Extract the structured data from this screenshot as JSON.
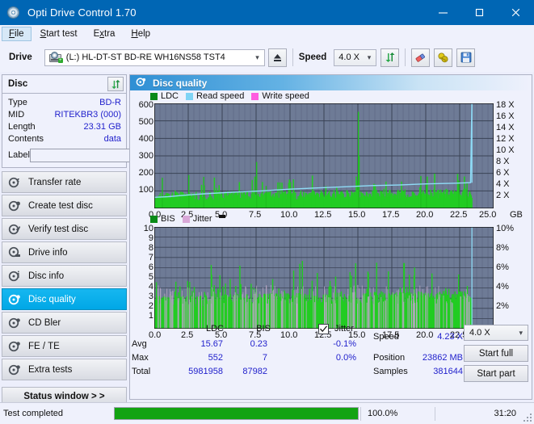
{
  "window": {
    "title": "Opti Drive Control 1.70",
    "icon": "disc-icon",
    "minimize": "minimize-icon",
    "maximize": "maximize-icon",
    "close": "close-icon",
    "titlebar_color": "#0066b4"
  },
  "menubar": {
    "items": [
      {
        "label": "File",
        "mnemonic": "F",
        "active": true
      },
      {
        "label": "Start test",
        "mnemonic": "S",
        "active": false
      },
      {
        "label": "Extra",
        "mnemonic": "x",
        "active": false
      },
      {
        "label": "Help",
        "mnemonic": "H",
        "active": false
      }
    ]
  },
  "toolbar": {
    "drive_label": "Drive",
    "drive_value": "(L:)  HL-DT-ST BD-RE  WH16NS58 TST4",
    "drive_icon": "drive-icon",
    "eject_icon": "eject-icon",
    "speed_label": "Speed",
    "speed_value": "4.0 X",
    "refresh_icon": "refresh-icon",
    "eraser_icon": "eraser-icon",
    "bulb_icon": "bulb-icon",
    "save_icon": "save-icon"
  },
  "disc_panel": {
    "title": "Disc",
    "refresh_icon": "refresh-icon",
    "rows": [
      {
        "key": "Type",
        "value": "BD-R"
      },
      {
        "key": "MID",
        "value": "RITEKBR3 (000)"
      },
      {
        "key": "Length",
        "value": "23.31 GB"
      },
      {
        "key": "Contents",
        "value": "data"
      }
    ],
    "label_key": "Label",
    "label_value": "",
    "label_placeholder": "",
    "label_icon": "cd-icon"
  },
  "sidebar": {
    "items": [
      {
        "label": "Transfer rate",
        "icon": "disc-test-icon",
        "selected": false
      },
      {
        "label": "Create test disc",
        "icon": "disc-write-icon",
        "selected": false
      },
      {
        "label": "Verify test disc",
        "icon": "disc-verify-icon",
        "selected": false
      },
      {
        "label": "Drive info",
        "icon": "drive-info-icon",
        "selected": false
      },
      {
        "label": "Disc info",
        "icon": "disc-info-icon",
        "selected": false
      },
      {
        "label": "Disc quality",
        "icon": "disc-quality-icon",
        "selected": true
      },
      {
        "label": "CD Bler",
        "icon": "cd-bler-icon",
        "selected": false
      },
      {
        "label": "FE / TE",
        "icon": "fe-te-icon",
        "selected": false
      },
      {
        "label": "Extra tests",
        "icon": "extra-tests-icon",
        "selected": false
      }
    ],
    "status_window_button": "Status window > >"
  },
  "main": {
    "title": "Disc quality",
    "icon": "disc-quality-icon"
  },
  "chart_data": [
    {
      "type": "line",
      "name": "ldc-chart",
      "title": "",
      "xlabel": "GB",
      "ylabel": "",
      "xlim": [
        0,
        25
      ],
      "xticks": [
        "0.0",
        "2.5",
        "5.0",
        "7.5",
        "10.0",
        "12.5",
        "15.0",
        "17.5",
        "20.0",
        "22.5",
        "25.0"
      ],
      "ylim": [
        0,
        600
      ],
      "yticks": [
        "100",
        "200",
        "300",
        "400",
        "500",
        "600"
      ],
      "y2label": "X",
      "y2lim": [
        0,
        18
      ],
      "y2ticks": [
        "2 X",
        "4 X",
        "6 X",
        "8 X",
        "10 X",
        "12 X",
        "14 X",
        "16 X",
        "18 X"
      ],
      "grid": true,
      "legend_position": "top-left",
      "plot_bg": "#6e7b96",
      "legend": [
        {
          "label": "LDC",
          "color": "#0a8a18"
        },
        {
          "label": "Read speed",
          "color": "#7fd4f5"
        },
        {
          "label": "Write speed",
          "color": "#ff5ce0"
        }
      ],
      "series": [
        {
          "name": "LDC",
          "color": "#22cc22",
          "type": "bar",
          "note": "dense green error bars, baseline ~40-90, spikes to 170/260/552",
          "x_end": 23.4,
          "avg": 15.67,
          "max": 552,
          "total": 5981958
        },
        {
          "name": "Read speed",
          "color": "#7fd4f5",
          "type": "line",
          "points": [
            [
              0.0,
              1.9
            ],
            [
              1.0,
              2.0
            ],
            [
              2.0,
              2.2
            ],
            [
              3.0,
              2.4
            ],
            [
              4.5,
              2.6
            ],
            [
              6.0,
              2.8
            ],
            [
              8.0,
              3.0
            ],
            [
              10.0,
              3.3
            ],
            [
              12.0,
              3.5
            ],
            [
              14.0,
              3.7
            ],
            [
              16.0,
              3.9
            ],
            [
              18.0,
              4.0
            ],
            [
              20.0,
              4.2
            ],
            [
              22.0,
              4.3
            ],
            [
              23.3,
              4.4
            ],
            [
              23.4,
              18.0
            ]
          ]
        }
      ]
    },
    {
      "type": "bar",
      "name": "bis-chart",
      "title": "",
      "xlabel": "GB",
      "ylabel": "",
      "xlim": [
        0,
        25
      ],
      "xticks": [
        "0.0",
        "2.5",
        "5.0",
        "7.5",
        "10.0",
        "12.5",
        "15.0",
        "17.5",
        "20.0",
        "22.5",
        "25.0"
      ],
      "ylim": [
        0,
        10
      ],
      "yticks": [
        "1",
        "2",
        "3",
        "4",
        "5",
        "6",
        "7",
        "8",
        "9",
        "10"
      ],
      "y2lim": [
        0,
        10
      ],
      "y2ticks": [
        "2%",
        "4%",
        "6%",
        "8%",
        "10%"
      ],
      "grid": true,
      "legend_position": "top-left",
      "plot_bg": "#6e7b96",
      "legend": [
        {
          "label": "BIS",
          "color": "#0a8a18"
        },
        {
          "label": "Jitter",
          "color": "#d8a8d8"
        }
      ],
      "series": [
        {
          "name": "BIS",
          "color": "#22cc22",
          "type": "bar",
          "note": "dense green bars baseline ~2-4, spikes to 5-7 toward end",
          "x_end": 23.4,
          "avg": 0.23,
          "max": 7,
          "total": 87982
        }
      ]
    }
  ],
  "stats": {
    "col_headers": [
      "LDC",
      "BIS"
    ],
    "row_labels": [
      "Avg",
      "Max",
      "Total"
    ],
    "ldc": {
      "avg": "15.67",
      "max": "552",
      "total": "5981958"
    },
    "bis": {
      "avg": "0.23",
      "max": "7",
      "total": "87982"
    },
    "jitter": {
      "label": "Jitter",
      "checked": true,
      "avg": "-0.1%",
      "max": "0.0%"
    },
    "speed_label": "Speed",
    "speed_value": "4.23 X",
    "position_label": "Position",
    "position_value": "23862 MB",
    "samples_label": "Samples",
    "samples_value": "381644",
    "speed_select": "4.0 X",
    "start_full_button": "Start full",
    "start_part_button": "Start part"
  },
  "statusbar": {
    "message": "Test completed",
    "progress_percent": "100.0%",
    "progress_value": 100,
    "elapsed": "31:20"
  }
}
